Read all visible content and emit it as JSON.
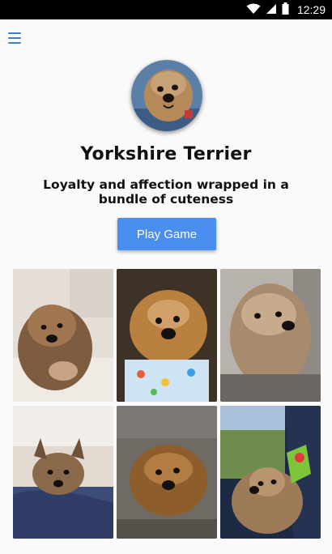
{
  "status_bar": {
    "time": "12:29",
    "icons": [
      "wifi-icon",
      "cell-signal-icon",
      "battery-icon"
    ]
  },
  "header": {
    "menu_icon": "hamburger-menu-icon"
  },
  "profile": {
    "title": "Yorkshire Terrier",
    "tagline": "Loyalty and affection wrapped in a bundle of cuteness"
  },
  "actions": {
    "play_label": "Play Game"
  },
  "gallery": {
    "photos": [
      {
        "name": "photo-1",
        "subject": "yorkie lying on blanket"
      },
      {
        "name": "photo-2",
        "subject": "yorkie in colorful shirt"
      },
      {
        "name": "photo-3",
        "subject": "yorkie in car seat"
      },
      {
        "name": "photo-4",
        "subject": "yorkie on bed"
      },
      {
        "name": "photo-5",
        "subject": "yorkie close-up"
      },
      {
        "name": "photo-6",
        "subject": "yorkie in car window with toy"
      }
    ]
  },
  "colors": {
    "accent": "#4a8ff0",
    "menu": "#3b82c4",
    "status_bar": "#000000",
    "background": "#fafafa"
  }
}
